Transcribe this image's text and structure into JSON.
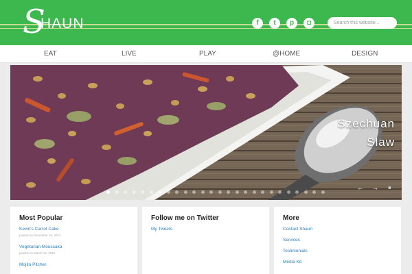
{
  "header": {
    "logo_initial": "S",
    "logo_rest": "HAUN",
    "social": [
      {
        "icon": "facebook-icon",
        "glyph": "f"
      },
      {
        "icon": "twitter-icon",
        "glyph": "t"
      },
      {
        "icon": "pinterest-icon",
        "glyph": "p"
      },
      {
        "icon": "instagram-icon",
        "glyph": "◘"
      }
    ],
    "search_placeholder": "Search this website..."
  },
  "nav": {
    "items": [
      {
        "label": "EAT"
      },
      {
        "label": "LIVE"
      },
      {
        "label": "PLAY"
      },
      {
        "label": "@HOME"
      },
      {
        "label": "DESIGN"
      }
    ]
  },
  "slider": {
    "title_line1": "Szechuan",
    "title_line2": "Slaw",
    "prev": "←",
    "next": "→",
    "pause": "⏸"
  },
  "widgets": {
    "popular": {
      "title": "Most Popular",
      "posts": [
        {
          "title": "Kevin's Carrot Cake",
          "meta": "posted on December 16, 2014"
        },
        {
          "title": "Vegetarian Moussaka",
          "meta": "posted on March 16, 2015"
        },
        {
          "title": "Mojito Pitcher",
          "meta": ""
        }
      ]
    },
    "twitter": {
      "title": "Follow me on Twitter",
      "link": "My Tweets"
    },
    "more": {
      "title": "More",
      "links": [
        "Contact Shaun",
        "Services",
        "Testimonials",
        "Media Kit"
      ]
    }
  },
  "colors": {
    "brand_green": "#3cb84f",
    "link_blue": "#2f7fbe"
  }
}
